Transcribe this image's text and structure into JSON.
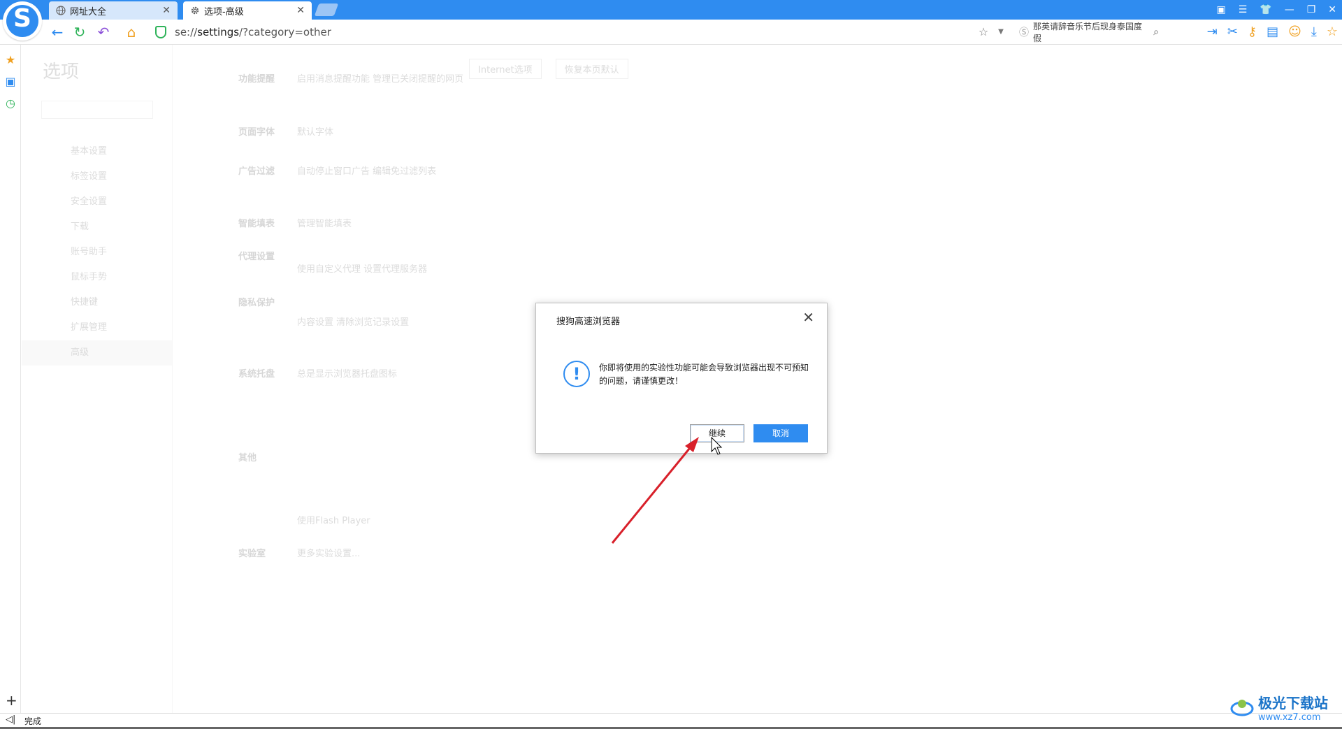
{
  "tabs": [
    {
      "label": "网址大全",
      "icon": "globe-icon"
    },
    {
      "label": "选项-高级",
      "icon": "gear-icon"
    }
  ],
  "address": {
    "prefix": "se://",
    "bold": "settings",
    "suffix": "/?category=other"
  },
  "search": {
    "text": "那英请辞音乐节后现身泰国度假"
  },
  "status": {
    "text": "完成"
  },
  "settings": {
    "title": "选项",
    "nav": [
      "基本设置",
      "标签设置",
      "安全设置",
      "下载",
      "账号助手",
      "鼠标手势",
      "快捷键",
      "扩展管理",
      "高级"
    ],
    "top_tabs": [
      "Internet选项",
      "恢复本页默认"
    ],
    "rows": [
      {
        "label": "功能提醒",
        "text": "启用消息提醒功能  管理已关闭提醒的网页"
      },
      {
        "label": "页面字体",
        "text": "默认字体"
      },
      {
        "label": "广告过滤",
        "text": "自动停止窗口广告  编辑免过滤列表"
      },
      {
        "label": "智能填表",
        "text": "管理智能填表"
      },
      {
        "label": "代理设置",
        "text": "使用自定义代理  设置代理服务器"
      },
      {
        "label": "隐私保护",
        "text": "内容设置  清除浏览记录设置"
      },
      {
        "label": "系统托盘",
        "text": "总是显示浏览器托盘图标"
      },
      {
        "label": "其他",
        "text": "使用Flash Player"
      },
      {
        "label": "实验室",
        "text": "更多实验设置..."
      }
    ]
  },
  "dialog": {
    "title": "搜狗高速浏览器",
    "message": "你即将使用的实验性功能可能会导致浏览器出现不可预知的问题，请谨慎更改！",
    "ok_label": "继续",
    "cancel_label": "取消"
  },
  "watermark": {
    "brand": "极光下载站",
    "site": "www.xz7.com"
  },
  "colors": {
    "accent": "#2f8cf0",
    "annotation_arrow": "#d8202a"
  }
}
